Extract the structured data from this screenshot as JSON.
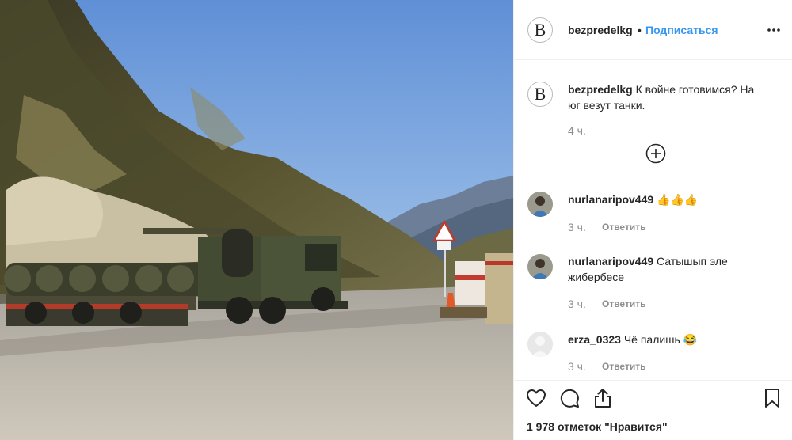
{
  "post": {
    "username": "bezpredelkg",
    "avatar_letter": "B",
    "separator": "•",
    "follow_label": "Подписаться",
    "more_icon": "more-horizontal-icon"
  },
  "caption": {
    "username": "bezpredelkg",
    "text_line1": "К войне готовимся? На",
    "text_line2": "юг везут танки.",
    "time": "4 ч."
  },
  "load_more_icon": "plus-circle-icon",
  "comments": [
    {
      "username": "nurlanaripov449",
      "text": "👍👍👍",
      "text_line2": "",
      "time": "3 ч.",
      "reply_label": "Ответить"
    },
    {
      "username": "nurlanaripov449",
      "text": "Сатышып эле",
      "text_line2": "жибербесе",
      "time": "3 ч.",
      "reply_label": "Ответить"
    },
    {
      "username": "erza_0323",
      "text": "Чё палишь 😂",
      "text_line2": "",
      "time": "3 ч.",
      "reply_label": "Ответить"
    }
  ],
  "action_icons": [
    "heart-icon",
    "comment-icon",
    "share-icon",
    "bookmark-icon"
  ],
  "likes": {
    "count": "1 978",
    "suffix": "отметок \"Нравится\""
  },
  "colors": {
    "link_blue": "#3897f0",
    "text_dark": "#262626",
    "text_gray": "#8e8e8e",
    "border": "#efefef"
  }
}
